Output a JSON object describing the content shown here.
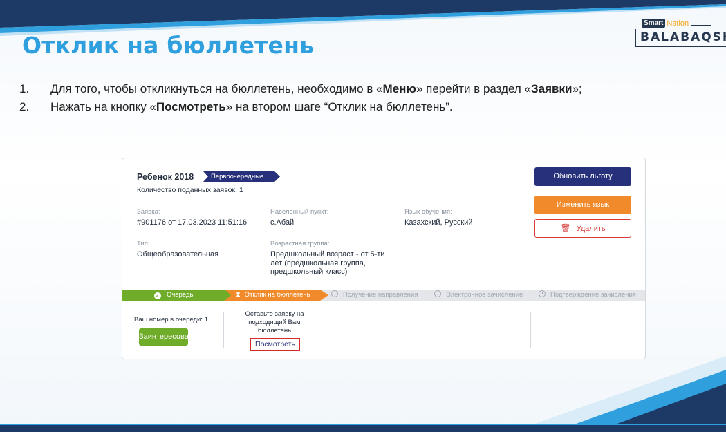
{
  "slide": {
    "title": "Отклик на бюллетень",
    "logo": {
      "top": "Smart",
      "top2": "Nation",
      "main": "BALABAQSH"
    }
  },
  "instructions": [
    {
      "num": "1.",
      "pre": "Для того, чтобы откликнуться на бюллетень, необходимо в «",
      "bold1": "Меню",
      "mid": "» перейти в раздел «",
      "bold2": "Заявки",
      "post": "»;"
    },
    {
      "num": "2.",
      "pre": "Нажать на кнопку «",
      "bold1": "Посмотреть",
      "mid": "» на втором шаге “Отклик на бюллетень”.",
      "bold2": "",
      "post": ""
    }
  ],
  "card": {
    "child_name": "Ребенок 2018",
    "tag": "Первоочередные",
    "count_text": "Количество поданных заявок: 1",
    "fields": {
      "application_label": "Заявка:",
      "application_value": "#901176 от 17.03.2023 11:51:16",
      "locality_label": "Населенный пункт:",
      "locality_value": "с.Абай",
      "language_label": "Язык обучения:",
      "language_value": "Казахский, Русский",
      "type_label": "Тип:",
      "type_value": "Общеобразовательная",
      "age_label": "Возрастная группа:",
      "age_value": "Предшкольный возраст - от 5-ти лет (предшкольная группа, предшкольный класс)"
    },
    "buttons": {
      "update": "Обновить льготу",
      "change_language": "Изменить язык",
      "delete": "Удалить"
    },
    "steps": [
      {
        "label": "Очередь",
        "state": "done"
      },
      {
        "label": "Отклик на бюллетень",
        "state": "active"
      },
      {
        "label": "Получение направления",
        "state": "pending"
      },
      {
        "label": "Электронное зачисление",
        "state": "pending"
      },
      {
        "label": "Подтверждение зачисления",
        "state": "pending"
      }
    ],
    "queue_text": "Ваш номер в очереди: 1",
    "interested_button": "Заинтересован",
    "leave_text": "Оставьте заявку на подходящий Вам бюллетень",
    "view_button": "Посмотреть"
  },
  "colors": {
    "title": "#2f9fde",
    "navy": "#27307a",
    "orange": "#f08a2a",
    "green": "#6fac2a",
    "red": "#d62a2a"
  }
}
